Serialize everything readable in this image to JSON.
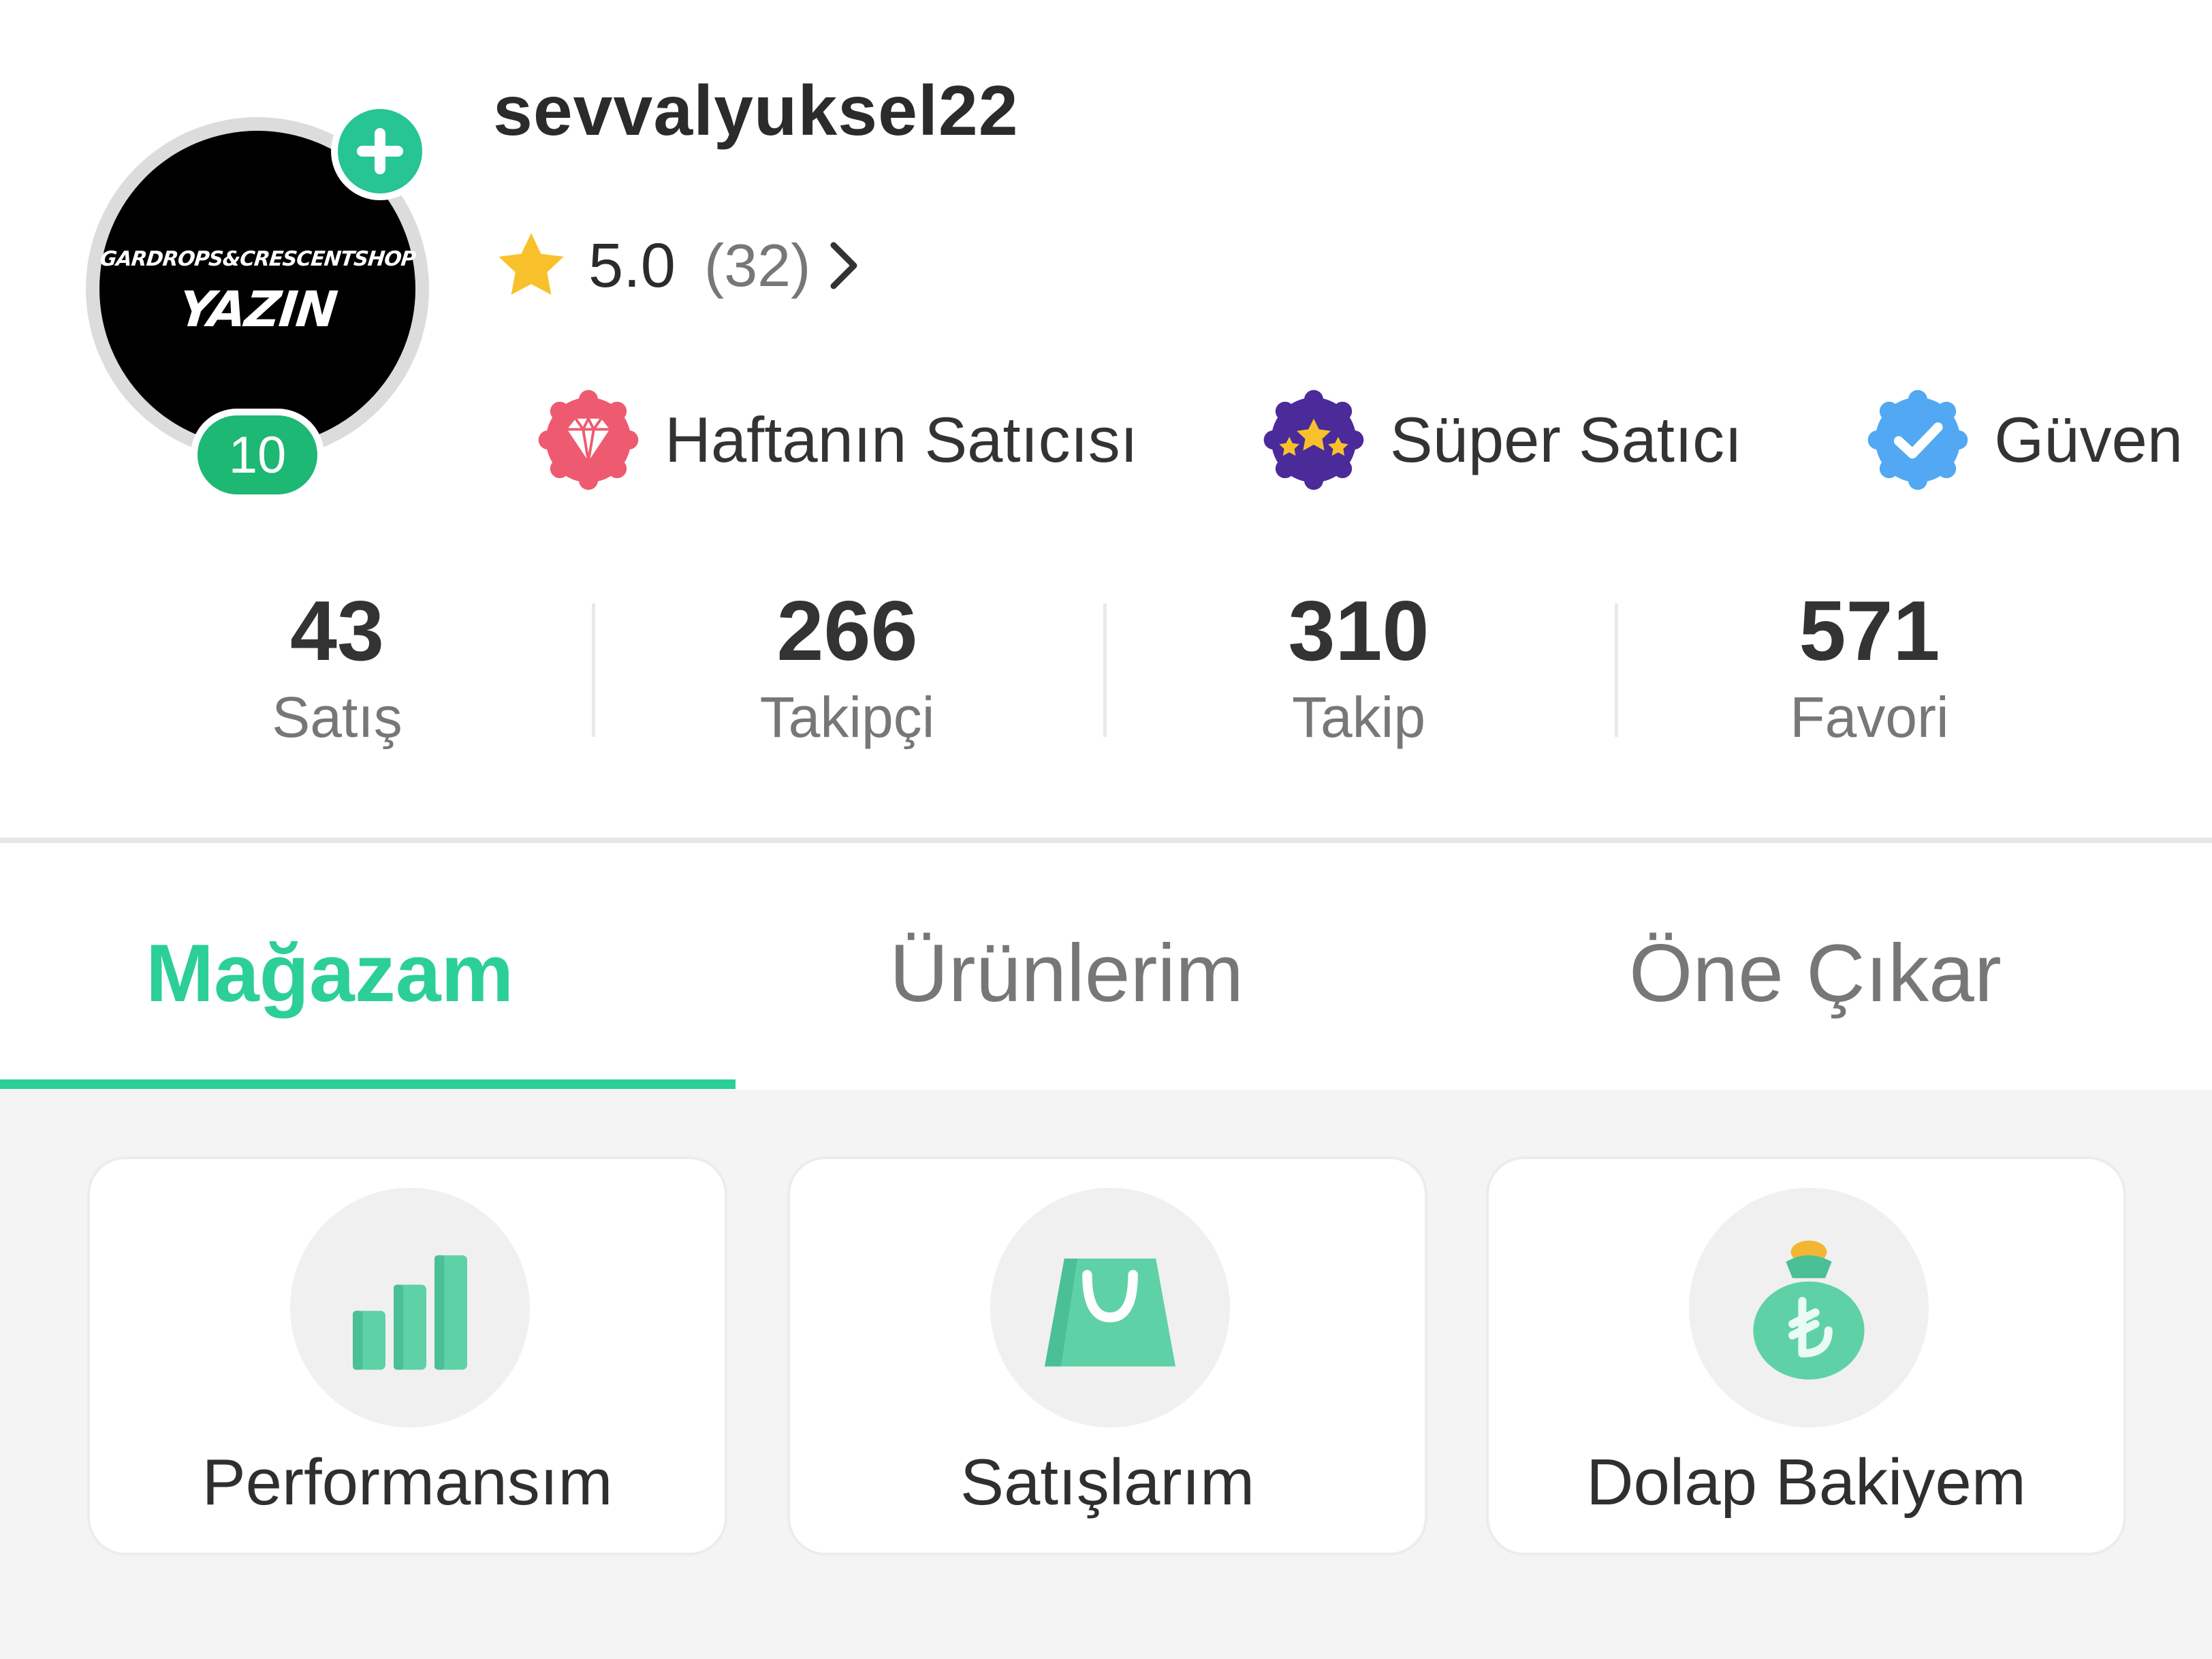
{
  "profile": {
    "username": "sevvalyuksel22",
    "avatar": {
      "shop_text": "GARDROPS&CRESCENTSHOP",
      "name_text": "YAZIN"
    },
    "level": "10",
    "rating": {
      "value": "5.0",
      "count": "(32)"
    },
    "badges": [
      {
        "icon": "diamond-badge-icon",
        "label": "Haftanın Satıcısı",
        "color": "#ee5a70"
      },
      {
        "icon": "super-seller-badge-icon",
        "label": "Süper Satıcı",
        "color": "#4b2a99"
      },
      {
        "icon": "verified-badge-icon",
        "label": "Güven",
        "color": "#52a8f2"
      }
    ]
  },
  "stats": [
    {
      "value": "43",
      "label": "Satış"
    },
    {
      "value": "266",
      "label": "Takipçi"
    },
    {
      "value": "310",
      "label": "Takip"
    },
    {
      "value": "571",
      "label": "Favori"
    }
  ],
  "tabs": [
    {
      "label": "Mağazam",
      "active": true
    },
    {
      "label": "Ürünlerim",
      "active": false
    },
    {
      "label": "Öne Çıkar",
      "active": false
    }
  ],
  "cards": [
    {
      "icon": "bar-chart-icon",
      "label": "Performansım"
    },
    {
      "icon": "shopping-bag-icon",
      "label": "Satışlarım"
    },
    {
      "icon": "money-bag-icon",
      "label": "Dolap Bakiyem"
    }
  ],
  "colors": {
    "accent": "#2ccf98",
    "level_badge": "#1db873",
    "add_button": "#27c494",
    "star": "#f8c12c"
  }
}
